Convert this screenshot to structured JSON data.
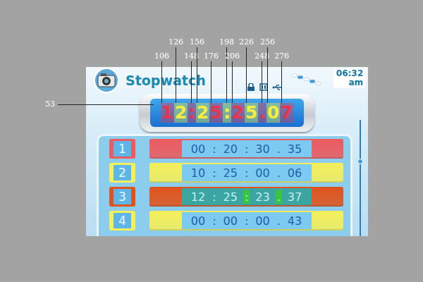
{
  "annotations": {
    "horizontal_marks": [
      "106",
      "126",
      "148",
      "156",
      "176",
      "198",
      "206",
      "226",
      "248",
      "256",
      "276"
    ],
    "vertical_marks": [
      "53"
    ]
  },
  "header": {
    "title": "Stopwatch",
    "clock": {
      "time": "06:32",
      "period": "am"
    }
  },
  "display": {
    "digits": [
      {
        "char": "1",
        "color": "#e8344c"
      },
      {
        "char": "2",
        "color": "#f4ee3c"
      },
      {
        "char": ":",
        "color": "#e8344c"
      },
      {
        "char": "2",
        "color": "#f4ee3c"
      },
      {
        "char": "5",
        "color": "#e8344c"
      },
      {
        "char": ":",
        "color": "#f4ee3c"
      },
      {
        "char": "2",
        "color": "#e8344c"
      },
      {
        "char": "5",
        "color": "#f4ee3c"
      },
      {
        "char": ".",
        "color": "#e8344c"
      },
      {
        "char": "0",
        "color": "#f4ee3c"
      },
      {
        "char": "7",
        "color": "#e8344c"
      }
    ]
  },
  "laps": [
    {
      "index": "1",
      "color": "#ec5b5f",
      "selected": false,
      "time": [
        {
          "text": "00",
          "highlight": false
        },
        {
          "text": ":",
          "highlight": false
        },
        {
          "text": "20",
          "highlight": false
        },
        {
          "text": ":",
          "highlight": false
        },
        {
          "text": "30",
          "highlight": false
        },
        {
          "text": ".",
          "highlight": false
        },
        {
          "text": "35",
          "highlight": false
        }
      ]
    },
    {
      "index": "2",
      "color": "#f4ef5a",
      "selected": false,
      "time": [
        {
          "text": "10",
          "highlight": false
        },
        {
          "text": ":",
          "highlight": false
        },
        {
          "text": "25",
          "highlight": false
        },
        {
          "text": ":",
          "highlight": false
        },
        {
          "text": "00",
          "highlight": false
        },
        {
          "text": ".",
          "highlight": false
        },
        {
          "text": "06",
          "highlight": false
        }
      ]
    },
    {
      "index": "3",
      "color": "#e0531c",
      "selected": true,
      "time": [
        {
          "text": "12",
          "highlight": false
        },
        {
          "text": ":",
          "highlight": false
        },
        {
          "text": "25",
          "highlight": false
        },
        {
          "text": ":",
          "highlight": true
        },
        {
          "text": "23",
          "highlight": false
        },
        {
          "text": ".",
          "highlight": true
        },
        {
          "text": "37",
          "highlight": false
        }
      ]
    },
    {
      "index": "4",
      "color": "#f4ef5a",
      "selected": false,
      "time": [
        {
          "text": "00",
          "highlight": false
        },
        {
          "text": ":",
          "highlight": false
        },
        {
          "text": "00",
          "highlight": false
        },
        {
          "text": ":",
          "highlight": false
        },
        {
          "text": "00",
          "highlight": false
        },
        {
          "text": ".",
          "highlight": false
        },
        {
          "text": "43",
          "highlight": false
        }
      ]
    }
  ],
  "scrollbar": {
    "level": 0.35
  }
}
